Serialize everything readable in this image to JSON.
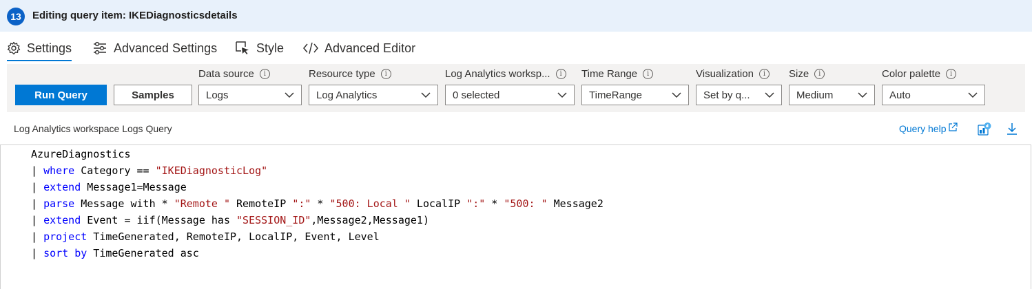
{
  "header": {
    "step": "13",
    "title": "Editing query item: IKEDiagnosticsdetails"
  },
  "tabs": [
    {
      "label": "Settings",
      "icon": "gear-icon",
      "active": true
    },
    {
      "label": "Advanced Settings",
      "icon": "sliders-icon"
    },
    {
      "label": "Style",
      "icon": "cursor-box-icon"
    },
    {
      "label": "Advanced Editor",
      "icon": "code-icon"
    }
  ],
  "toolbar": {
    "run_query": "Run Query",
    "samples": "Samples",
    "fields": [
      {
        "label": "Data source",
        "value": "Logs"
      },
      {
        "label": "Resource type",
        "value": "Log Analytics"
      },
      {
        "label": "Log Analytics worksp...",
        "value": "0 selected"
      },
      {
        "label": "Time Range",
        "value": "TimeRange"
      },
      {
        "label": "Visualization",
        "value": "Set by q..."
      },
      {
        "label": "Size",
        "value": "Medium"
      },
      {
        "label": "Color palette",
        "value": "Auto"
      }
    ]
  },
  "query": {
    "label": "Log Analytics workspace Logs Query",
    "help": "Query help",
    "lines": [
      "AzureDiagnostics",
      "| where Category == \"IKEDiagnosticLog\"",
      "| extend Message1=Message",
      "| parse Message with * \"Remote \" RemoteIP \":\" * \"500: Local \" LocalIP \":\" * \"500: \" Message2",
      "| extend Event = iif(Message has \"SESSION_ID\",Message2,Message1)",
      "| project TimeGenerated, RemoteIP, LocalIP, Event, Level",
      "| sort by TimeGenerated asc"
    ]
  },
  "colors": {
    "accent": "#0078d4",
    "header_bg": "#e8f1fb",
    "toolbar_bg": "#f3f2f1",
    "keyword": "#0000ff",
    "string": "#a31515"
  }
}
